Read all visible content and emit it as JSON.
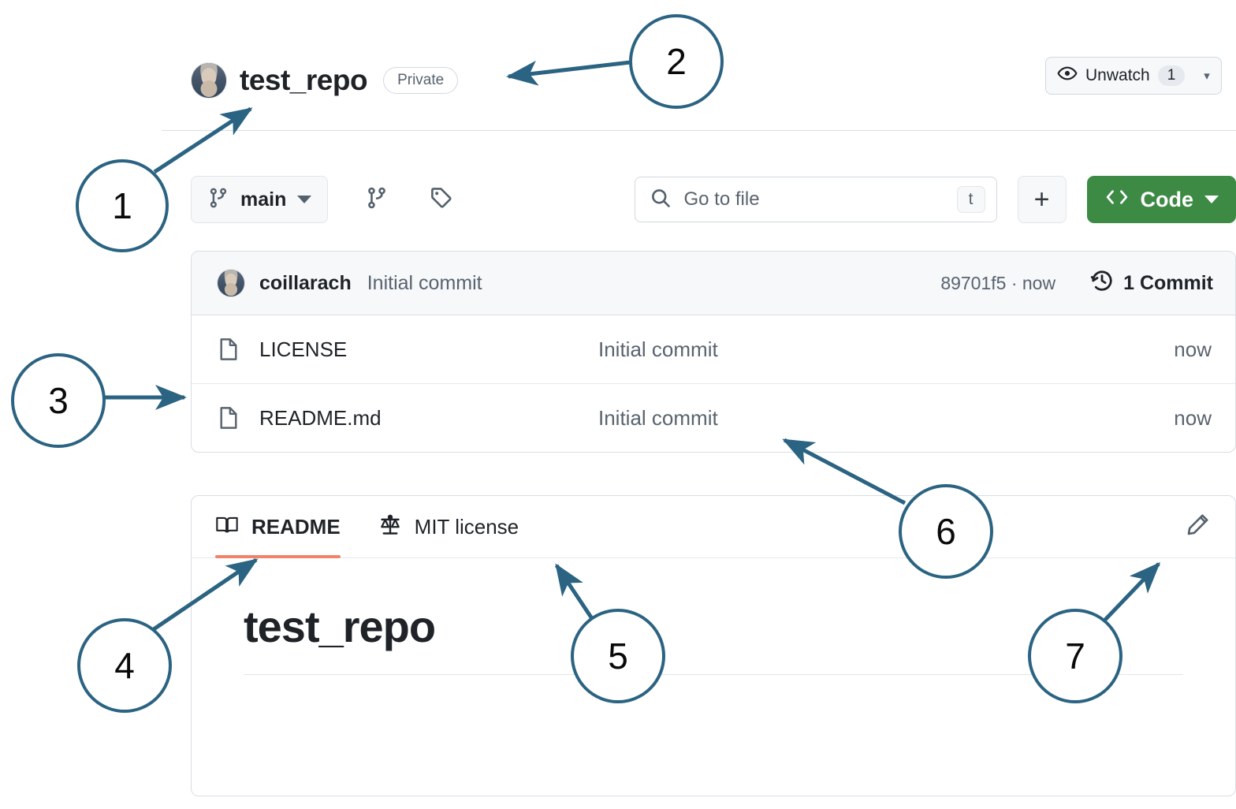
{
  "repo": {
    "owner_avatar": "user-avatar",
    "name": "test_repo",
    "visibility": "Private",
    "watch": {
      "label": "Unwatch",
      "count": "1"
    }
  },
  "toolbar": {
    "branch": "main",
    "branch_icon": "git-branch-icon",
    "branches_icon": "git-branch-icon",
    "tags_icon": "tag-icon",
    "search": {
      "placeholder": "Go to file",
      "value": "",
      "shortcut": "t",
      "icon": "search-icon"
    },
    "add_label": "+",
    "code_label": "Code",
    "code_icon": "code-brackets-icon",
    "code_color": "#3d8a45"
  },
  "files": {
    "commit_bar": {
      "avatar": "user-avatar",
      "author": "coillarach",
      "message": "Initial commit",
      "hash_and_time": "89701f5 · now",
      "history_icon": "history-icon",
      "commit_count": "1 Commit"
    },
    "columns": [
      "name",
      "message",
      "time"
    ],
    "rows": [
      {
        "icon": "file-icon",
        "name": "LICENSE",
        "message": "Initial commit",
        "time": "now"
      },
      {
        "icon": "file-icon",
        "name": "README.md",
        "message": "Initial commit",
        "time": "now"
      }
    ]
  },
  "readme": {
    "tabs": [
      {
        "label": "README",
        "icon": "book-icon",
        "active": true
      },
      {
        "label": "MIT license",
        "icon": "scales-icon",
        "active": false
      }
    ],
    "active_underline_color": "#f0846a",
    "edit_icon": "pencil-icon",
    "heading": "test_repo"
  },
  "annotations": {
    "color": "#2b6382",
    "items": [
      {
        "number": "1",
        "target": "repo-title"
      },
      {
        "number": "2",
        "target": "visibility-badge"
      },
      {
        "number": "3",
        "target": "file-list"
      },
      {
        "number": "4",
        "target": "readme-tab"
      },
      {
        "number": "5",
        "target": "mit-license-tab"
      },
      {
        "number": "6",
        "target": "readme-row-commit-message"
      },
      {
        "number": "7",
        "target": "edit-readme-icon"
      }
    ]
  }
}
